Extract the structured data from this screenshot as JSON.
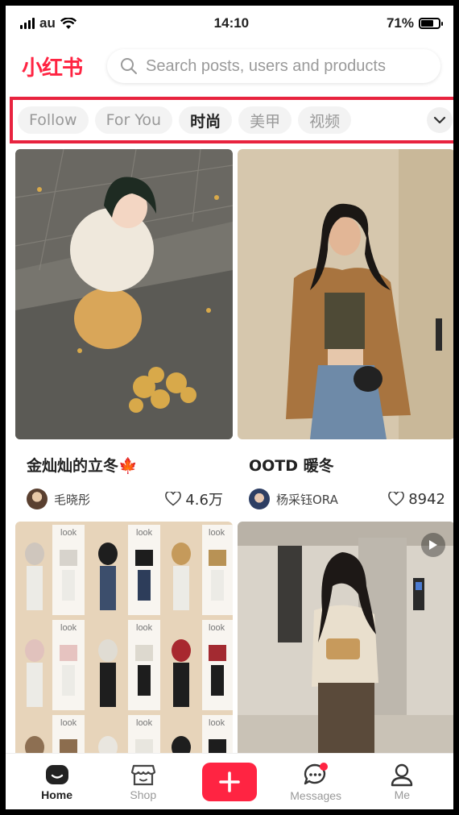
{
  "status_bar": {
    "carrier": "au",
    "time": "14:10",
    "battery": "71%",
    "battery_level": 0.71
  },
  "header": {
    "logo": "小红书",
    "search_placeholder": "Search posts, users and products"
  },
  "tabs": [
    {
      "label": "Follow"
    },
    {
      "label": "For You"
    },
    {
      "label": "时尚",
      "active": true
    },
    {
      "label": "美甲"
    },
    {
      "label": "视频"
    }
  ],
  "feed": [
    {
      "title": "金灿灿的立冬",
      "emoji": "🍁",
      "author": "毛晓彤",
      "likes": "4.6万"
    },
    {
      "title": "OOTD 暖冬",
      "author": "杨采钰ORA",
      "likes": "8942"
    },
    {
      "grid_label": "look"
    },
    {
      "video": true
    }
  ],
  "bottom_nav": {
    "home": "Home",
    "shop": "Shop",
    "messages": "Messages",
    "me": "Me"
  },
  "colors": {
    "brand": "#ff2442",
    "highlight_border": "#e8233f"
  }
}
